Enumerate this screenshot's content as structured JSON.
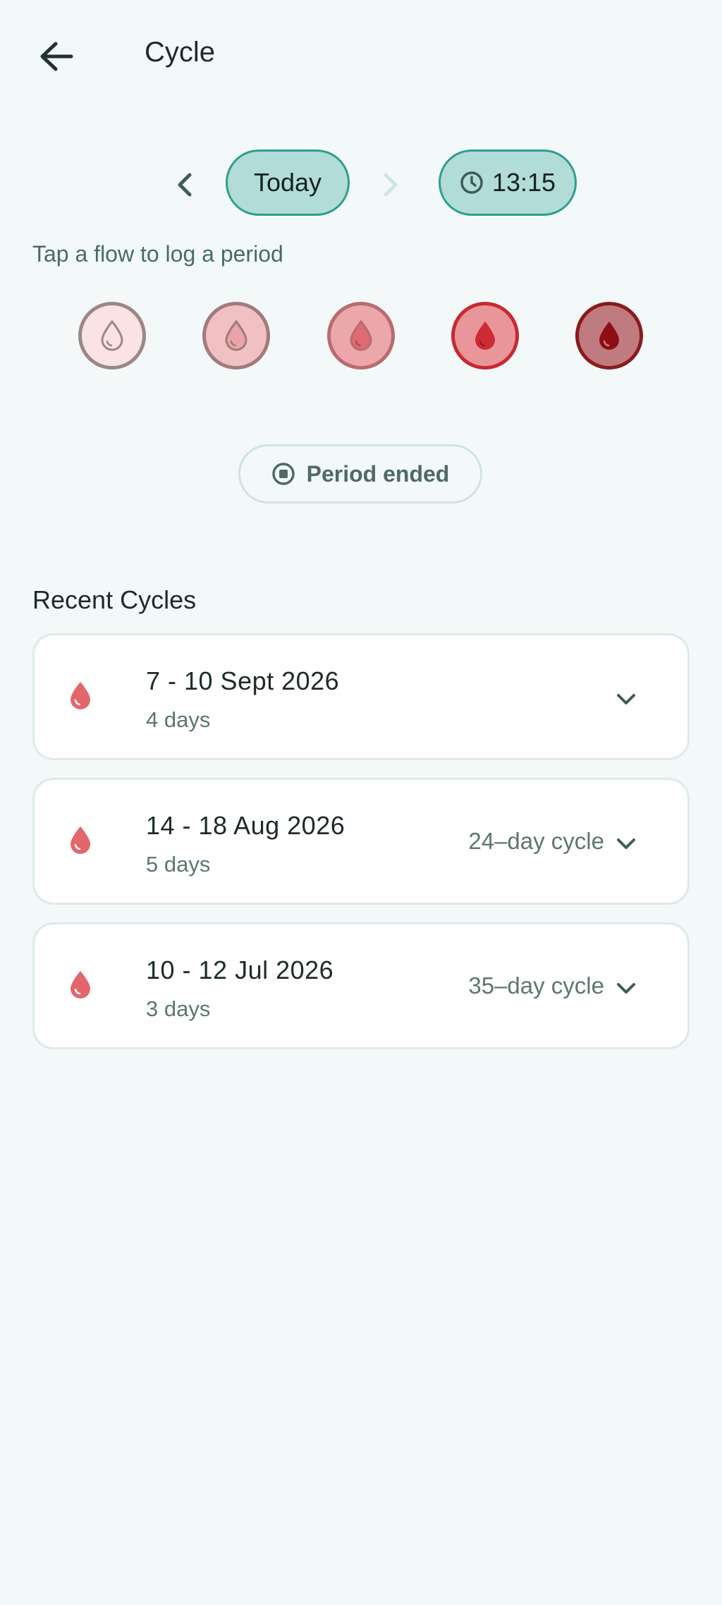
{
  "header": {
    "title": "Cycle"
  },
  "date_selector": {
    "date_label": "Today",
    "time_label": "13:15"
  },
  "flow_section": {
    "hint": "Tap a flow to log a period",
    "levels": [
      {
        "fill": "#fbe3e5",
        "ring": "#9b8788",
        "drop": "#fbe3e5",
        "drop_outline": "#9b8788"
      },
      {
        "fill": "#f1c0c3",
        "ring": "#a17b7e",
        "drop": "#eaa4a8",
        "drop_outline": "#a17b7e"
      },
      {
        "fill": "#eba7aa",
        "ring": "#ba6b70",
        "drop": "#e06a72",
        "drop_outline": "#ba6b70"
      },
      {
        "fill": "#e89699",
        "ring": "#c72a32",
        "drop": "#cf2a33",
        "drop_outline": "#cf2a33"
      },
      {
        "fill": "#c07b80",
        "ring": "#8a1a1f",
        "drop": "#8f0d14",
        "drop_outline": "#8f0d14"
      }
    ]
  },
  "period_ended_button": {
    "label": "Period ended"
  },
  "recent_cycles": {
    "title": "Recent Cycles",
    "items": [
      {
        "range": "7 - 10 Sept 2026",
        "duration": "4 days",
        "cycle_length": ""
      },
      {
        "range": "14 - 18 Aug 2026",
        "duration": "5 days",
        "cycle_length": "24–day cycle"
      },
      {
        "range": "10 - 12 Jul 2026",
        "duration": "3 days",
        "cycle_length": "35–day cycle"
      }
    ]
  },
  "colors": {
    "background": "#f3f9f9",
    "accent": "#2e9e90",
    "accent_fill": "#b2dcd8",
    "drop": "#e2666c",
    "muted_text": "#5d7771"
  }
}
